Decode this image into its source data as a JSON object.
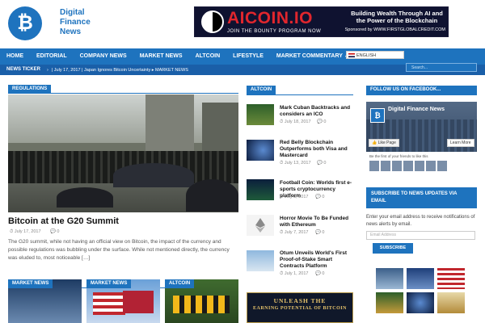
{
  "header": {
    "brand_line1": "Digital",
    "brand_line2": "Finance",
    "brand_line3": "News",
    "logo_glyph": "₿"
  },
  "ad": {
    "title": "AICOIN.IO",
    "subtitle": "JOIN THE BOUNTY PROGRAM NOW",
    "tagline": "Building Wealth Through AI and the Power of the Blockchain",
    "sponsor": "Sponsored by WWW.FIRSTGLOBALCREDIT.COM"
  },
  "nav": {
    "items": [
      "HOME",
      "EDITORIAL",
      "COMPANY NEWS",
      "MARKET NEWS",
      "ALTCOIN",
      "LIFESTYLE",
      "MARKET COMMENTARY ⌄"
    ],
    "language": "ENGLISH"
  },
  "ticker": {
    "label": "NEWS TICKER",
    "arrow": "›",
    "text": "| July 17, 2017 | Japan Ignores Bitcoin Uncertainty  ▸ MARKET NEWS"
  },
  "search": {
    "placeholder": "Search..."
  },
  "featured": {
    "tag": "REGULATIONS",
    "title": "Bitcoin at the G20 Summit",
    "date": "⏱ July 17, 2017",
    "comments": "💬 0",
    "excerpt": "The G20 summit, while not having an official view on Bitcoin, the impact of the currency and possible regulations was bubbling under the surface. While not mentioned directly, the currency was eluded to, most noticeable […]"
  },
  "altcoin": {
    "tag": "ALTCOIN",
    "items": [
      {
        "title": "Mark Cuban Backtracks and considers an ICO",
        "date": "⏱ July 18, 2017",
        "comments": "💬 0"
      },
      {
        "title": "Red Belly Blockchain Outperforms both Visa and Mastercard",
        "date": "⏱ July 13, 2017",
        "comments": "💬 0"
      },
      {
        "title": "Football Coin: Worlds first e-sports cryptocurrency platform",
        "date": "⏱ July 8, 2017",
        "comments": "💬 0"
      },
      {
        "title": "Horror Movie To Be Funded with Ethereum",
        "date": "⏱ July 7, 2017",
        "comments": "💬 0"
      },
      {
        "title": "Otum Unveils World's First Proof-of-Stake Smart Contracts Platform",
        "date": "⏱ July 1, 2017",
        "comments": "💬 0"
      }
    ]
  },
  "bottom_tags": [
    "MARKET NEWS",
    "MARKET NEWS",
    "ALTCOIN"
  ],
  "bitcoin_banner": {
    "line1": "UNLEASH THE",
    "line2": "EARNING POTENTIAL OF BITCOIN"
  },
  "sidebar": {
    "facebook_tag": "FOLLOW US ON FACEBOOK...",
    "fb_page_name": "Digital Finance News",
    "fb_like": "👍 Like Page",
    "fb_learn": "Learn More",
    "fb_friends": "Be the first of your friends to like this",
    "subscribe_title": "SUBSCRIBE TO NEWS UPDATES VIA EMAIL",
    "subscribe_text": "Enter your email address to receive notifications of news alerts by email.",
    "email_placeholder": "Email Address",
    "subscribe_button": "SUBSCRIBE"
  },
  "colors": {
    "accent": "#1e73be",
    "ad_red": "#e1262d"
  }
}
